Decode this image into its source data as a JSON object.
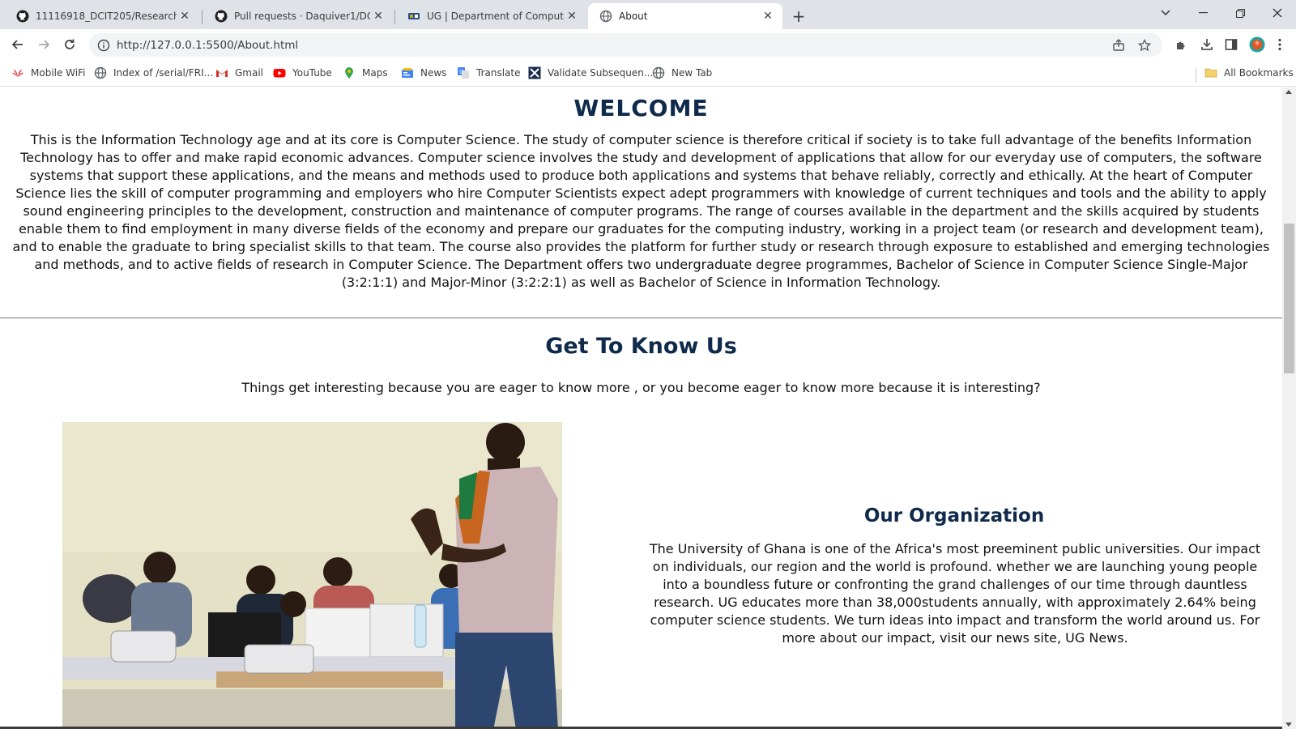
{
  "browser": {
    "tabs": [
      {
        "title": "11116918_DCIT205/Research.css",
        "icon": "github-icon",
        "active": false
      },
      {
        "title": "Pull requests · Daquiver1/DCIT_2",
        "icon": "github-icon",
        "active": false
      },
      {
        "title": "UG | Department of Computer S",
        "icon": "ug-logo-icon",
        "active": false
      },
      {
        "title": "About",
        "icon": "globe-icon",
        "active": true
      }
    ],
    "url": "http://127.0.0.1:5500/About.html",
    "bookmarks": [
      {
        "label": "Mobile WiFi",
        "icon": "huawei-icon"
      },
      {
        "label": "Index of /serial/FRI...",
        "icon": "globe-icon"
      },
      {
        "label": "Gmail",
        "icon": "gmail-icon"
      },
      {
        "label": "YouTube",
        "icon": "youtube-icon"
      },
      {
        "label": "Maps",
        "icon": "maps-icon"
      },
      {
        "label": "News",
        "icon": "news-icon"
      },
      {
        "label": "Translate",
        "icon": "translate-icon"
      },
      {
        "label": "Validate Subsequen...",
        "icon": "validate-icon"
      },
      {
        "label": "New Tab",
        "icon": "globe-icon"
      }
    ],
    "all_bookmarks_label": "All Bookmarks"
  },
  "page": {
    "welcome": {
      "title": "WELCOME",
      "text": "This is the Information Technology age and at its core is Computer Science. The study of computer science is therefore critical if society is to take full advantage of the benefits Information Technology has to offer and make rapid economic advances. Computer science involves the study and development of applications that allow for our everyday use of computers, the software systems that support these applications, and the means and methods used to produce both applications and systems that behave reliably, correctly and ethically. At the heart of Computer Science lies the skill of computer programming and employers who hire Computer Scientists expect adept programmers with knowledge of current techniques and tools and the ability to apply sound engineering principles to the development, construction and maintenance of computer programs. The range of courses available in the department and the skills acquired by students enable them to find employment in many diverse fields of the economy and prepare our graduates for the computing industry, working in a project team (or research and development team), and to enable the graduate to bring specialist skills to that team. The course also provides the platform for further study or research through exposure to established and emerging technologies and methods, and to active fields of research in Computer Science. The Department offers two undergraduate degree programmes, Bachelor of Science in Computer Science Single-Major (3:2:1:1) and Major-Minor (3:2:2:1) as well as Bachelor of Science in Information Technology."
    },
    "get_to_know": {
      "title": "Get To Know Us",
      "subtitle": "Things get interesting because you are eager to know more , or you become eager to know more because it is interesting?"
    },
    "organization": {
      "title": "Our Organization",
      "text": "The University of Ghana is one of the Africa's most preeminent public universities. Our impact on individuals, our region and the world is profound. whether we are launching young people into a boundless future or confronting the grand challenges of our time through dauntless research. UG educates more than 38,000students annually, with approximately 2.64% being computer science students. We turn ideas into impact and transform the world around us. For more about our impact, visit our news site, UG News."
    }
  },
  "colors": {
    "heading": "#0f2a4a",
    "tabstrip": "#dfe3e8"
  }
}
